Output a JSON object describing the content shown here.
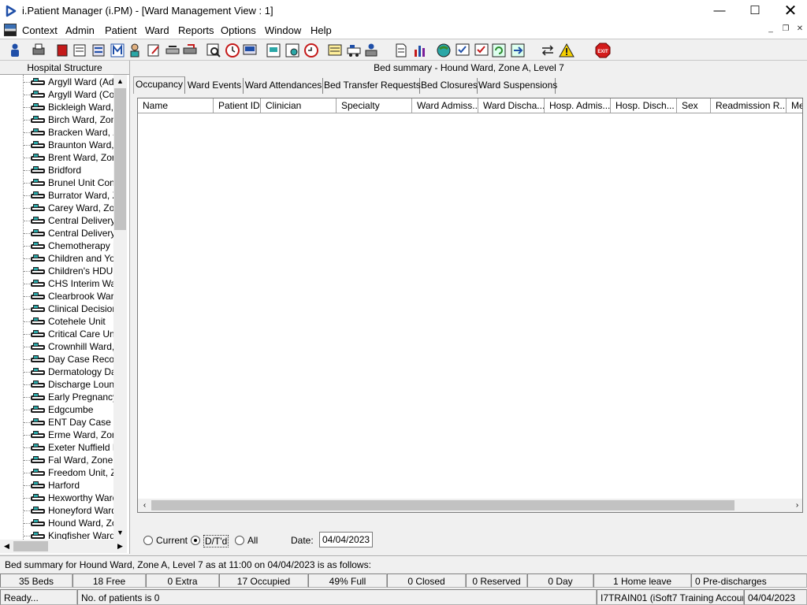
{
  "window": {
    "title": "i.Patient Manager (i.PM) - [Ward Management View : 1]",
    "controls": {
      "minimize": "—",
      "maximize": "☐",
      "close": "✕"
    }
  },
  "menu": {
    "items": [
      "Context",
      "Admin",
      "Patient",
      "Ward",
      "Reports",
      "Options",
      "Window",
      "Help"
    ],
    "mdi_controls": {
      "minimize": "_",
      "restore": "❐",
      "close": "✕"
    }
  },
  "toolbar": {
    "exit_label": "EXIT"
  },
  "left_panel": {
    "header": "Hospital Structure",
    "tree_items": [
      "Argyll Ward (Adult",
      "Argyll Ward (Cots",
      "Bickleigh Ward, Z",
      "Birch Ward, Zone",
      "Bracken Ward, Zo",
      "Braunton Ward, Z",
      "Brent Ward, Zone",
      "Bridford",
      "Brunel Unit Contin",
      "Burrator Ward, Zo",
      "Carey Ward, Zone",
      "Central Delivery S",
      "Central Delivery S",
      "Chemotherapy Da",
      "Children and You",
      "Children's HDU (N",
      "CHS Interim Ward",
      "Clearbrook Ward,",
      "Clinical Decision U",
      "Cotehele Unit",
      "Critical Care Unit",
      "Crownhill Ward, Z",
      "Day Case Recov",
      "Dermatology Day",
      "Discharge Loung",
      "Early Pregnancy U",
      "Edgcumbe",
      "ENT Day Case U",
      "Erme Ward, Zone",
      "Exeter Nuffield H",
      "Fal Ward, Zone B",
      "Freedom Unit, Zo",
      "Harford",
      "Hexworthy Ward,",
      "Honeyford Ward,",
      "Hound Ward, Zon",
      "Kingfisher Ward"
    ]
  },
  "main": {
    "bed_summary_title": "Bed summary - Hound Ward, Zone A, Level 7",
    "tabs": [
      "Occupancy",
      "Ward Events",
      "Ward Attendances",
      "Bed Transfer Requests",
      "Bed Closures",
      "Ward Suspensions"
    ],
    "active_tab": "Occupancy",
    "columns": [
      "Name",
      "Patient ID",
      "Clinician",
      "Specialty",
      "Ward Admiss...",
      "Ward Discha...",
      "Hosp. Admis...",
      "Hosp. Disch...",
      "Sex",
      "Readmission R...",
      "Me"
    ],
    "filters": {
      "current": "Current",
      "dtd": "D/T'd",
      "all": "All",
      "selected": "D/T'd",
      "date_label": "Date:",
      "date_value": "04/04/2023"
    }
  },
  "summary_line": "Bed summary for Hound Ward, Zone A, Level 7 as at 11:00 on 04/04/2023 is as follows:",
  "stats": {
    "beds": "35 Beds",
    "free": "18 Free",
    "extra": "0 Extra",
    "occupied": "17 Occupied",
    "full": "49% Full",
    "closed": "0 Closed",
    "reserved": "0 Reserved",
    "day": "0 Day",
    "home_leave": "1 Home leave",
    "pre_discharges": "0 Pre-discharges"
  },
  "status_bar": {
    "state": "Ready...",
    "patients": "No. of patients is 0",
    "account": "I7TRAIN01 (iSoft7 Training Account)",
    "date": "04/04/2023"
  },
  "colors": {
    "accent_teal": "#2aa7a7",
    "exit_red": "#d41c1c",
    "app_icon_blue": "#1f4fa8"
  }
}
